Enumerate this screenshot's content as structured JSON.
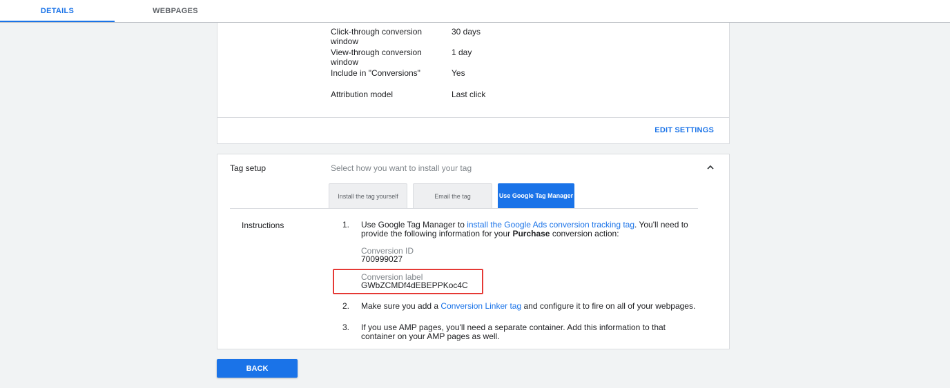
{
  "tabs": {
    "details": "DETAILS",
    "webpages": "WEBPAGES"
  },
  "settings": {
    "rows": [
      {
        "label": "Click-through conversion window",
        "value": "30 days"
      },
      {
        "label": "View-through conversion window",
        "value": "1 day"
      },
      {
        "label": "Include in \"Conversions\"",
        "value": "Yes"
      },
      {
        "label": "Attribution model",
        "value": "Last click"
      }
    ],
    "edit_label": "EDIT SETTINGS"
  },
  "tag_setup": {
    "title": "Tag setup",
    "subtitle": "Select how you want to install your tag",
    "options": {
      "install_yourself": "Install the tag yourself",
      "email": "Email the tag",
      "gtm": "Use Google Tag Manager"
    },
    "instructions_label": "Instructions",
    "step1": {
      "num": "1.",
      "text_a": "Use Google Tag Manager to ",
      "link": "install the Google Ads conversion tracking tag",
      "text_b": ". You'll need to provide the following information for your ",
      "bold": "Purchase",
      "text_c": " conversion action:"
    },
    "conversion_id": {
      "label": "Conversion ID",
      "value": "700999027"
    },
    "conversion_label": {
      "label": "Conversion label",
      "value": "GWbZCMDf4dEBEPPKoc4C"
    },
    "step2": {
      "num": "2.",
      "text_a": "Make sure you add a ",
      "link": "Conversion Linker tag",
      "text_b": " and configure it to fire on all of your webpages."
    },
    "step3": {
      "num": "3.",
      "text": "If you use AMP pages, you'll need a separate container. Add this information to that container on your AMP pages as well."
    }
  },
  "back_label": "BACK",
  "colors": {
    "accent": "#1a73e8",
    "highlight": "#e53935"
  }
}
